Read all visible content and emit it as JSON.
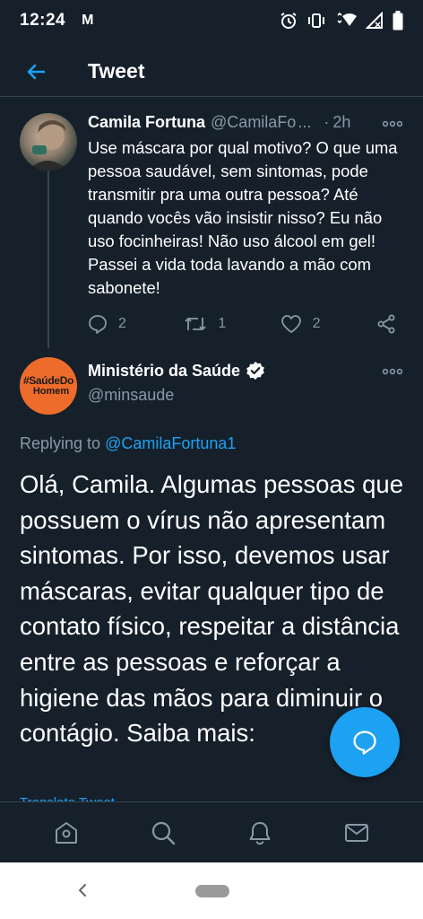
{
  "status_bar": {
    "time": "12:24",
    "notification_glyph": "M",
    "icons": [
      "alarm-icon",
      "vibrate-icon",
      "wifi-icon",
      "signal-icon",
      "battery-icon"
    ]
  },
  "header": {
    "title": "Tweet",
    "back_icon": "arrow-left-icon"
  },
  "tweet_parent": {
    "author_name": "Camila Fortuna",
    "author_handle": "@CamilaFo",
    "handle_ellipsis": "...",
    "separator": "·",
    "time": "2h",
    "text": "Use máscara por qual motivo? O que uma pessoa saudável, sem sintomas, pode transmitir pra uma outra pessoa? Até quando vocês vão insistir nisso? Eu não uso focinheiras! Não uso álcool em gel! Passei a vida toda lavando a mão com sabonete!",
    "replies": "2",
    "retweets": "1",
    "likes": "2"
  },
  "tweet_main": {
    "author_name": "Ministério da Saúde",
    "author_handle": "@minsaude",
    "avatar_text_line1": "#SaúdeDo",
    "avatar_text_line2": "Homem",
    "replying_label": "Replying to",
    "replying_to": "@CamilaFortuna1",
    "text": "Olá, Camila. Algumas pessoas que possuem o vírus não apresentam sintomas. Por isso, devemos usar máscaras, evitar qualquer tipo de contato físico, respeitar a distância entre as pessoas e reforçar a higiene das mãos para diminuir o contágio. Saiba mais:",
    "translate_label": "Translate Tweet"
  },
  "colors": {
    "background": "#15202b",
    "accent": "#1da1f2",
    "secondary_text": "#8899a6",
    "divider": "#38444d",
    "avatar_orange": "#ee6c2b"
  },
  "bottom_nav": {
    "items": [
      "home-icon",
      "search-icon",
      "notifications-icon",
      "messages-icon"
    ]
  }
}
